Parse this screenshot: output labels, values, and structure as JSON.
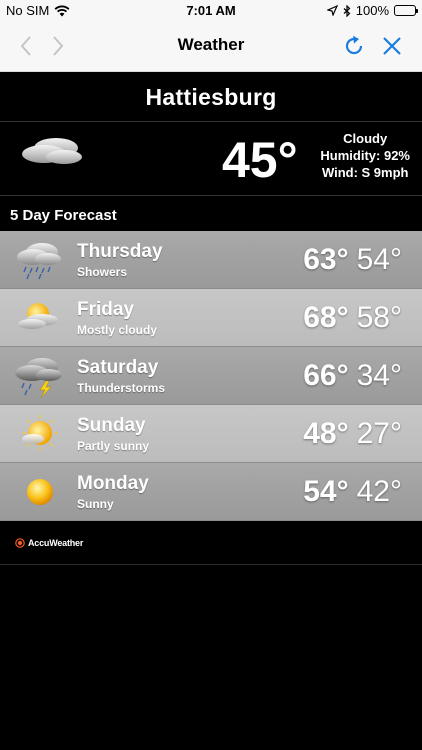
{
  "status_bar": {
    "carrier": "No SIM",
    "time": "7:01 AM",
    "battery": "100%",
    "battery_level": 1.0
  },
  "nav": {
    "title": "Weather"
  },
  "location": {
    "city": "Hattiesburg"
  },
  "current": {
    "icon": "cloudy-icon",
    "temperature": "45°",
    "condition": "Cloudy",
    "humidity": "Humidity: 92%",
    "wind": "Wind: S 9mph"
  },
  "forecast": {
    "header": "5 Day Forecast",
    "days": [
      {
        "day": "Thursday",
        "condition": "Showers",
        "high": "63°",
        "low": "54°",
        "icon": "showers-icon"
      },
      {
        "day": "Friday",
        "condition": "Mostly cloudy",
        "high": "68°",
        "low": "58°",
        "icon": "mostly-cloudy-icon"
      },
      {
        "day": "Saturday",
        "condition": "Thunderstorms",
        "high": "66°",
        "low": "34°",
        "icon": "thunderstorm-icon"
      },
      {
        "day": "Sunday",
        "condition": "Partly sunny",
        "high": "48°",
        "low": "27°",
        "icon": "partly-sunny-icon"
      },
      {
        "day": "Monday",
        "condition": "Sunny",
        "high": "54°",
        "low": "42°",
        "icon": "sunny-icon"
      }
    ]
  },
  "footer": {
    "brand": "AccuWeather"
  },
  "colors": {
    "accent": "#1a7ee0",
    "brand_orange": "#f15a22",
    "row_dark": "#a3a3a3",
    "row_light": "#c3c3c3"
  }
}
